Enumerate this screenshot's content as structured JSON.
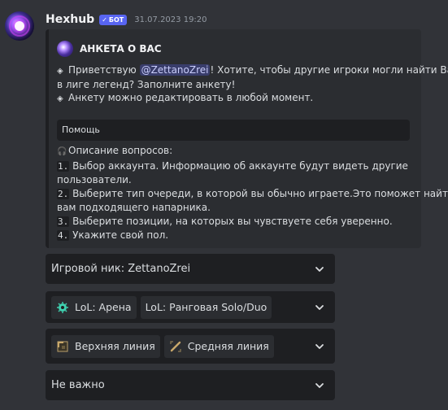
{
  "message": {
    "username": "Hexhub",
    "bot_tag": "БОТ",
    "timestamp": "31.07.2023 19:20"
  },
  "embed": {
    "author": "АНКЕТА О ВАС",
    "line1_prefix": "Приветствую ",
    "mention": "@ZettanoZrei",
    "line1_suffix": "! Хотите, чтобы другие игроки могли найти Вас",
    "line2": "в лиге легенд? Заполните анкету!",
    "line3": "Анкету можно редактировать в любой момент.",
    "help_label": "Помощь",
    "questions_title": "Описание вопросов:",
    "questions": [
      {
        "num": "1.",
        "line1": "Выбор аккаунта. Информацию об аккаунте будут видеть другие",
        "line2": "пользователи."
      },
      {
        "num": "2.",
        "line1": "Выберите тип очереди, в которой вы обычно играете.Это поможет найти",
        "line2": "вам подходящего напарника."
      },
      {
        "num": "3.",
        "line1": "Выберите позиции, на которых вы чувствуете себя уверенно.",
        "line2": ""
      },
      {
        "num": "4.",
        "line1": "Укажите свой пол.",
        "line2": ""
      }
    ]
  },
  "selects": {
    "nickname": "Игровой ник: ZettanoZrei",
    "queues": [
      "LoL: Арена",
      "LoL: Ранговая Solo/Duo"
    ],
    "positions": [
      "Верхняя линия",
      "Средняя линия"
    ],
    "gender": "Не важно"
  },
  "colors": {
    "background": "#313338",
    "embed": "#2b2d31",
    "select": "#1e1f22",
    "bot_tag": "#5865f2",
    "mention": "#c9cdfb"
  },
  "icons": {
    "arena": "arena-icon",
    "ranked": "ranked-icon",
    "top": "top-lane-icon",
    "mid": "mid-lane-icon",
    "chevron": "chevron-down-icon"
  }
}
